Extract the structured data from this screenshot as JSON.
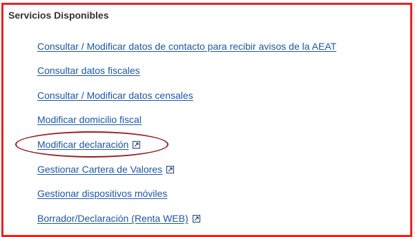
{
  "panel": {
    "title": "Servicios Disponibles",
    "border_color": "#e52420"
  },
  "services": [
    {
      "label": "Consultar / Modificar datos de contacto para recibir avisos de la AEAT",
      "external": false
    },
    {
      "label": "Consultar datos fiscales",
      "external": false
    },
    {
      "label": "Consultar / Modificar datos censales",
      "external": false
    },
    {
      "label": "Modificar domicilio fiscal",
      "external": false
    },
    {
      "label": "Modificar declaración",
      "external": true,
      "highlighted": true
    },
    {
      "label": "Gestionar Cartera de Valores",
      "external": true
    },
    {
      "label": "Gestionar dispositivos móviles",
      "external": false
    },
    {
      "label": "Borrador/Declaración (Renta WEB)",
      "external": true
    }
  ],
  "icons": {
    "external": "external-link-icon"
  },
  "colors": {
    "link": "#1a56a6",
    "highlight_oval": "#9a1c1c"
  }
}
